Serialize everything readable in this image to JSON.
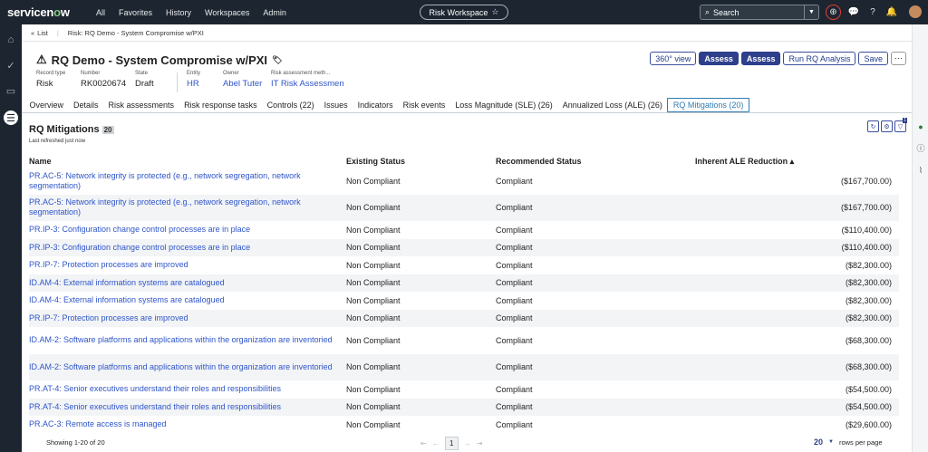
{
  "topbar": {
    "logo_a": "servicen",
    "logo_o": "o",
    "logo_b": "w",
    "nav": [
      "All",
      "Favorites",
      "History",
      "Workspaces",
      "Admin"
    ],
    "workspace": "Risk Workspace",
    "search_placeholder": "Search"
  },
  "breadcrumb": {
    "list": "List",
    "current": "Risk: RQ Demo - System Compromise w/PXI"
  },
  "record": {
    "title": "RQ Demo - System Compromise w/PXI",
    "fields": [
      {
        "label": "Record type",
        "value": "Risk"
      },
      {
        "label": "Number",
        "value": "RK0020674"
      },
      {
        "label": "State",
        "value": "Draft"
      },
      {
        "label": "Entity",
        "value": "HR"
      },
      {
        "label": "Owner",
        "value": "Abel Tuter"
      },
      {
        "label": "Risk assessment meth...",
        "value": "IT Risk Assessmen"
      }
    ],
    "buttons": {
      "view360": "360° view",
      "assess1": "Assess",
      "assess2": "Assess",
      "run": "Run RQ Analysis",
      "save": "Save",
      "more": "⋯"
    }
  },
  "tabs": [
    "Overview",
    "Details",
    "Risk assessments",
    "Risk response tasks",
    "Controls (22)",
    "Issues",
    "Indicators",
    "Risk events",
    "Loss Magnitude (SLE) (26)",
    "Annualized Loss (ALE) (26)",
    "RQ Mitigations (20)"
  ],
  "panel": {
    "title": "RQ Mitigations",
    "count": "20",
    "refreshed": "Last refreshed just now",
    "filter_badge": "1",
    "columns": {
      "name": "Name",
      "existing": "Existing Status",
      "recommended": "Recommended Status",
      "ale": "Inherent ALE Reduction ▴"
    }
  },
  "rows": [
    {
      "name": "PR.AC-5: Network integrity is protected (e.g., network segregation, network segmentation)",
      "existing": "Non Compliant",
      "recommended": "Compliant",
      "ale": "($167,700.00)"
    },
    {
      "name": "PR.AC-5: Network integrity is protected (e.g., network segregation, network segmentation)",
      "existing": "Non Compliant",
      "recommended": "Compliant",
      "ale": "($167,700.00)"
    },
    {
      "name": "PR.IP-3: Configuration change control processes are in place",
      "existing": "Non Compliant",
      "recommended": "Compliant",
      "ale": "($110,400.00)"
    },
    {
      "name": "PR.IP-3: Configuration change control processes are in place",
      "existing": "Non Compliant",
      "recommended": "Compliant",
      "ale": "($110,400.00)"
    },
    {
      "name": "PR.IP-7: Protection processes are improved",
      "existing": "Non Compliant",
      "recommended": "Compliant",
      "ale": "($82,300.00)"
    },
    {
      "name": "ID.AM-4: External information systems are catalogued",
      "existing": "Non Compliant",
      "recommended": "Compliant",
      "ale": "($82,300.00)"
    },
    {
      "name": "ID.AM-4: External information systems are catalogued",
      "existing": "Non Compliant",
      "recommended": "Compliant",
      "ale": "($82,300.00)"
    },
    {
      "name": "PR.IP-7: Protection processes are improved",
      "existing": "Non Compliant",
      "recommended": "Compliant",
      "ale": "($82,300.00)"
    },
    {
      "name": "ID.AM-2: Software platforms and applications within the organization are inventoried",
      "existing": "Non Compliant",
      "recommended": "Compliant",
      "ale": "($68,300.00)"
    },
    {
      "name": "ID.AM-2: Software platforms and applications within the organization are inventoried",
      "existing": "Non Compliant",
      "recommended": "Compliant",
      "ale": "($68,300.00)"
    },
    {
      "name": "PR.AT-4: Senior executives understand their roles and responsibilities",
      "existing": "Non Compliant",
      "recommended": "Compliant",
      "ale": "($54,500.00)"
    },
    {
      "name": "PR.AT-4: Senior executives understand their roles and responsibilities",
      "existing": "Non Compliant",
      "recommended": "Compliant",
      "ale": "($54,500.00)"
    },
    {
      "name": "PR.AC-3: Remote access is managed",
      "existing": "Non Compliant",
      "recommended": "Compliant",
      "ale": "($29,600.00)"
    }
  ],
  "footer": {
    "showing": "Showing 1-20 of 20",
    "page": "1",
    "rows_per_page": "20",
    "rows_label": "rows per page"
  }
}
